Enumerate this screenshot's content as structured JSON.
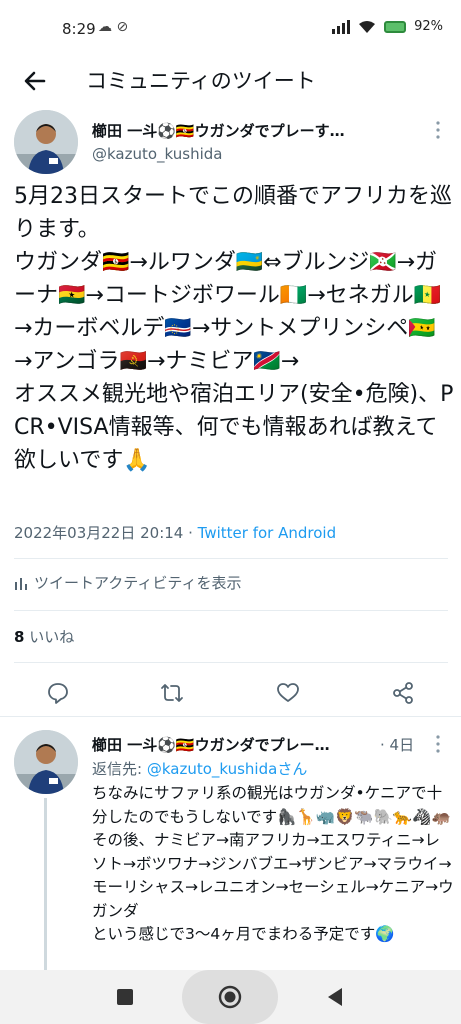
{
  "status_bar": {
    "time": "8:29",
    "left_icons": "☁ ⊘",
    "battery_percent": "92%"
  },
  "header": {
    "title": "コミュニティのツイート"
  },
  "main_tweet": {
    "author_name": "櫛田 一斗⚽🇺🇬ウガンダでプレーす…",
    "author_handle": "@kazuto_kushida",
    "body": "5月23日スタートでこの順番でアフリカを巡ります。\nウガンダ🇺🇬→ルワンダ🇷🇼⇔ブルンジ🇧🇮→ガーナ🇬🇭→コートジボワール🇨🇮→セネガル🇸🇳→カーボベルデ🇨🇻→サントメプリンシペ🇸🇹→アンゴラ🇦🇴→ナミビア🇳🇦→\nオススメ観光地や宿泊エリア(安全•危険)、PCR•VISA情報等、何でも情報あれば教えて欲しいです🙏",
    "timestamp": "2022年03月22日 20:14",
    "separator": " · ",
    "source": "Twitter for Android",
    "activity_label": "ツイートアクティビティを表示",
    "like_count": "8",
    "like_label": "いいね"
  },
  "reply_tweet": {
    "author_name": "櫛田 一斗⚽🇺🇬ウガンダでプレー…",
    "time": "· 4日",
    "reply_prefix": "返信先: ",
    "reply_mention": "@kazuto_kushidaさん",
    "body": "ちなみにサファリ系の観光はウガンダ•ケニアで十分したのでもうしないです🦍🦒🦏🦁🐃🐘🐆🦓🦛\nその後、ナミビア→南アフリカ→エスワティニ→レソト→ボツワナ→ジンバブエ→ザンビア→マラウイ→モーリシャス→レユニオン→セーシェル→ケニア→ウガンダ\nという感じで3〜4ヶ月でまわる予定です🌍"
  },
  "colors": {
    "link": "#1d9bf0",
    "secondary_text": "#536471",
    "divider": "#e6ecf0"
  }
}
